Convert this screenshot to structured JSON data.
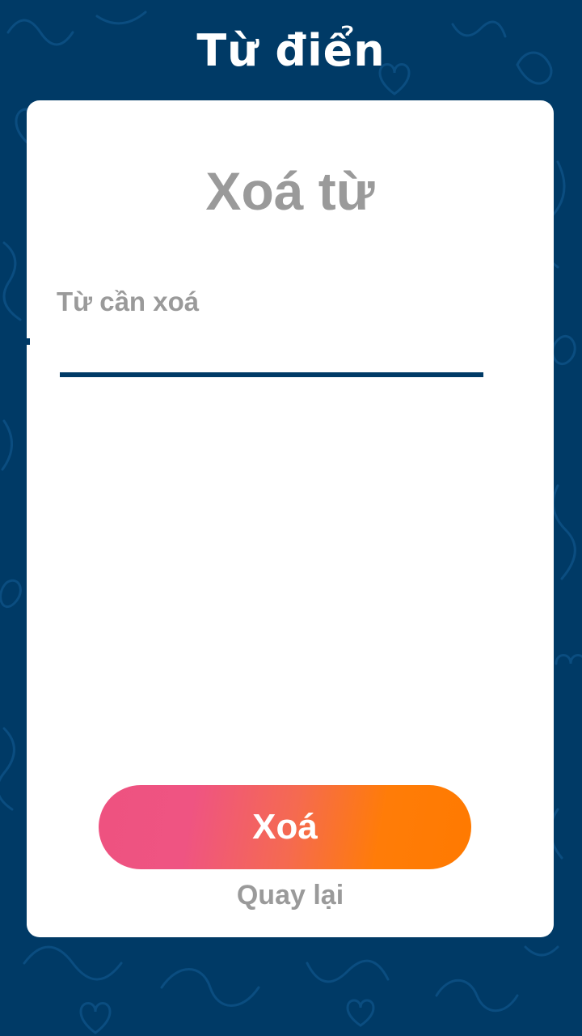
{
  "header": {
    "app_title": "Từ điển"
  },
  "dialog": {
    "title": "Xoá từ",
    "field_label": "Từ cần xoá",
    "field_value": "",
    "field_placeholder": "",
    "delete_label": "Xoá",
    "back_label": "Quay lại"
  },
  "colors": {
    "background": "#003a66",
    "card": "#ffffff",
    "muted_text": "#9a9a9a",
    "accent_line": "#003a66",
    "button_gradient_start": "#ee5280",
    "button_gradient_end": "#ff7a00"
  }
}
